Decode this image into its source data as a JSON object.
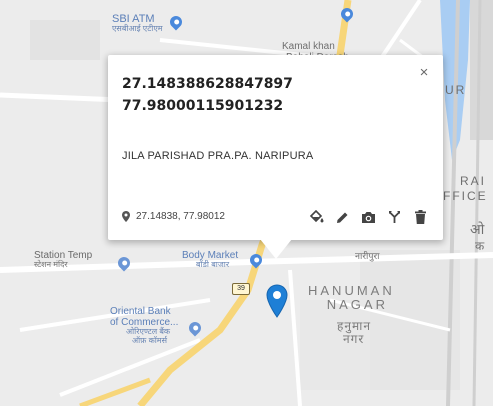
{
  "map": {
    "labels": {
      "sbi_atm": "SBI ATM",
      "sbi_atm_hi": "एसबीआई एटीएम",
      "kamal_khan_1": "Kamal khan",
      "kamal_khan_2": "Baheli Darsah",
      "station_temple": "Station Temp",
      "station_temple_hi": "स्टेशन मंदिर",
      "body_market": "Body Market",
      "body_market_hi": "बॉडी बाजार",
      "road_shield": "39",
      "naripura_hi": "नारीपुरा",
      "hanuman_1": "HANUMAN",
      "hanuman_2": "NAGAR",
      "hanuman_hi_1": "हनुमान",
      "hanuman_hi_2": "नगर",
      "oriental_1": "Oriental Bank",
      "oriental_2": "of Commerce...",
      "oriental_hi_1": "ओरिएण्टल बैंक",
      "oriental_hi_2": "ऑफ़ कॉमर्स",
      "cut_ur": "UR",
      "cut_rai": "RAI",
      "cut_fice": "FFICE",
      "cut_hi": "ओ",
      "cut_hi2": "क"
    },
    "colors": {
      "background": "#ececec",
      "road_major": "#f7d67a",
      "road_minor": "#ffffff",
      "water": "#a9cdf3",
      "poi_blue": "#4a89dc",
      "marker": "#1e7fd6"
    }
  },
  "info_window": {
    "lat": "27.148388628847897",
    "lng": "77.98000115901232",
    "place": "JILA PARISHAD PRA.PA. NARIPURA",
    "short_coords": "27.14838, 77.98012",
    "close_label": "×",
    "tools": [
      "paint-bucket-icon",
      "pencil-icon",
      "camera-icon",
      "directions-icon",
      "trash-icon"
    ]
  }
}
